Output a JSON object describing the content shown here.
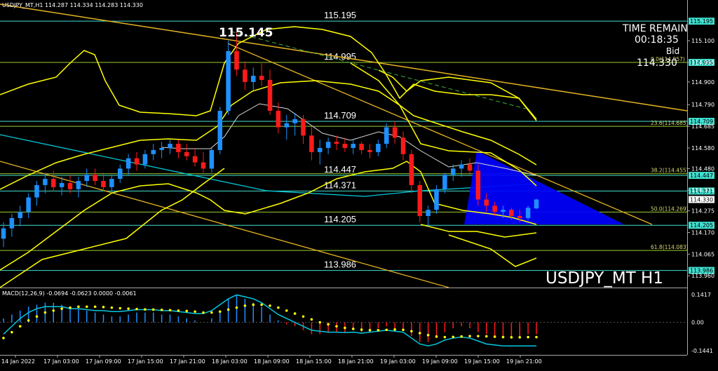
{
  "header": {
    "symbol_info": "USDJPY_MT,H1  114.287 114.334 114.283 114.330",
    "macd_info": "MACD(12,26,9) -0.0694 -0.0623 0.0000 -0.0061"
  },
  "overlay": {
    "time_remain_label": "TIME REMAIN",
    "time_remain_value": "00:18:35",
    "bid_label": "Bid",
    "bid_value": "114.330",
    "symbol_big": "USDJPY_MT H1",
    "peak_label": "115.145"
  },
  "colors": {
    "background": "#000000",
    "bull_candle": "#1e90ff",
    "bear_candle": "#ff1a1a",
    "bollinger": "#ffff00",
    "ma_fast": "#d8d8d8",
    "ma_cyan": "#00c8d8",
    "h_level": "#40e0d0",
    "fib_level": "#9acd32",
    "trendline": "#e6b422",
    "triangle": "#0000ff",
    "macd_signal": "#ffff00",
    "macd_line": "#00c8e0"
  },
  "levels": [
    {
      "price": 115.195,
      "label": "115.195",
      "axis": "115.195"
    },
    {
      "price": 114.995,
      "label": "114.995",
      "axis": "114.995"
    },
    {
      "price": 114.709,
      "label": "114.709",
      "axis": "114.709"
    },
    {
      "price": 114.447,
      "label": "114.447",
      "axis": "114.447"
    },
    {
      "price": 114.371,
      "label": "114.371",
      "axis": "114.371"
    },
    {
      "price": 114.205,
      "label": "114.205",
      "axis": "114.205"
    },
    {
      "price": 113.986,
      "label": "113.986",
      "axis": "113.986"
    }
  ],
  "fib_levels": [
    {
      "price": 114.995,
      "label": "0.0(114.957)"
    },
    {
      "price": 114.685,
      "label": "23.6(114.685)"
    },
    {
      "price": 114.455,
      "label": "38.2(114.455)"
    },
    {
      "price": 114.269,
      "label": "50.0(114.269)"
    },
    {
      "price": 114.083,
      "label": "61.8(114.083)"
    }
  ],
  "price_axis_ticks": [
    "115.100",
    "114.995",
    "114.900",
    "114.790",
    "114.685",
    "114.580",
    "114.480",
    "114.375",
    "114.275",
    "114.170",
    "114.065",
    "113.960"
  ],
  "macd_axis_ticks": [
    "0.1417",
    "0.00",
    "-0.1441"
  ],
  "time_axis": [
    "14 Jan 2022",
    "17 Jan 03:00",
    "17 Jan 09:00",
    "17 Jan 15:00",
    "17 Jan 21:00",
    "18 Jan 03:00",
    "18 Jan 09:00",
    "18 Jan 15:00",
    "18 Jan 21:00",
    "19 Jan 03:00",
    "19 Jan 09:00",
    "19 Jan 15:00",
    "19 Jan 21:00"
  ],
  "chart_data": {
    "type": "candlestick",
    "y_range": [
      113.92,
      115.25
    ],
    "current_price": 114.33,
    "candles": [
      [
        114.14,
        114.22,
        114.1,
        114.19
      ],
      [
        114.19,
        114.26,
        114.15,
        114.24
      ],
      [
        114.24,
        114.3,
        114.2,
        114.27
      ],
      [
        114.27,
        114.36,
        114.24,
        114.34
      ],
      [
        114.34,
        114.42,
        114.3,
        114.4
      ],
      [
        114.4,
        114.46,
        114.36,
        114.43
      ],
      [
        114.43,
        114.47,
        114.37,
        114.39
      ],
      [
        114.39,
        114.44,
        114.35,
        114.41
      ],
      [
        114.41,
        114.45,
        114.36,
        114.38
      ],
      [
        114.38,
        114.44,
        114.34,
        114.42
      ],
      [
        114.42,
        114.48,
        114.39,
        114.45
      ],
      [
        114.45,
        114.48,
        114.4,
        114.42
      ],
      [
        114.42,
        114.46,
        114.37,
        114.39
      ],
      [
        114.39,
        114.45,
        114.36,
        114.43
      ],
      [
        114.43,
        114.5,
        114.41,
        114.48
      ],
      [
        114.48,
        114.55,
        114.45,
        114.53
      ],
      [
        114.53,
        114.56,
        114.47,
        114.5
      ],
      [
        114.5,
        114.57,
        114.48,
        114.55
      ],
      [
        114.55,
        114.6,
        114.52,
        114.57
      ],
      [
        114.57,
        114.61,
        114.53,
        114.58
      ],
      [
        114.58,
        114.62,
        114.55,
        114.6
      ],
      [
        114.6,
        114.62,
        114.53,
        114.56
      ],
      [
        114.56,
        114.6,
        114.52,
        114.54
      ],
      [
        114.54,
        114.58,
        114.49,
        114.51
      ],
      [
        114.51,
        114.56,
        114.46,
        114.48
      ],
      [
        114.48,
        114.58,
        114.46,
        114.57
      ],
      [
        114.57,
        114.78,
        114.55,
        114.76
      ],
      [
        114.76,
        115.1,
        114.74,
        115.05
      ],
      [
        115.05,
        115.14,
        114.93,
        114.96
      ],
      [
        114.96,
        115.0,
        114.86,
        114.9
      ],
      [
        114.9,
        114.97,
        114.86,
        114.93
      ],
      [
        114.93,
        114.99,
        114.88,
        114.91
      ],
      [
        114.91,
        114.96,
        114.74,
        114.76
      ],
      [
        114.76,
        114.8,
        114.65,
        114.68
      ],
      [
        114.68,
        114.74,
        114.62,
        114.7
      ],
      [
        114.7,
        114.75,
        114.64,
        114.72
      ],
      [
        114.72,
        114.74,
        114.6,
        114.64
      ],
      [
        114.64,
        114.68,
        114.52,
        114.56
      ],
      [
        114.56,
        114.62,
        114.5,
        114.58
      ],
      [
        114.58,
        114.63,
        114.55,
        114.61
      ],
      [
        114.61,
        114.64,
        114.57,
        114.6
      ],
      [
        114.6,
        114.63,
        114.56,
        114.58
      ],
      [
        114.58,
        114.62,
        114.55,
        114.6
      ],
      [
        114.6,
        114.61,
        114.55,
        114.57
      ],
      [
        114.57,
        114.6,
        114.53,
        114.56
      ],
      [
        114.56,
        114.62,
        114.54,
        114.6
      ],
      [
        114.6,
        114.7,
        114.58,
        114.68
      ],
      [
        114.68,
        114.71,
        114.6,
        114.63
      ],
      [
        114.63,
        114.66,
        114.52,
        114.55
      ],
      [
        114.55,
        114.57,
        114.36,
        114.4
      ],
      [
        114.4,
        114.42,
        114.22,
        114.25
      ],
      [
        114.25,
        114.3,
        114.2,
        114.28
      ],
      [
        114.28,
        114.4,
        114.26,
        114.38
      ],
      [
        114.38,
        114.46,
        114.36,
        114.45
      ],
      [
        114.45,
        114.5,
        114.42,
        114.48
      ],
      [
        114.48,
        114.52,
        114.44,
        114.5
      ],
      [
        114.5,
        114.53,
        114.45,
        114.47
      ],
      [
        114.47,
        114.5,
        114.3,
        114.33
      ],
      [
        114.33,
        114.36,
        114.27,
        114.3
      ],
      [
        114.3,
        114.32,
        114.25,
        114.27
      ],
      [
        114.27,
        114.3,
        114.24,
        114.28
      ],
      [
        114.28,
        114.29,
        114.23,
        114.25
      ],
      [
        114.25,
        114.28,
        114.22,
        114.24
      ],
      [
        114.24,
        114.3,
        114.23,
        114.29
      ],
      [
        114.287,
        114.334,
        114.283,
        114.33
      ]
    ],
    "macd": {
      "histogram": [
        0.02,
        0.04,
        0.06,
        0.08,
        0.09,
        0.1,
        0.1,
        0.09,
        0.08,
        0.07,
        0.06,
        0.05,
        0.04,
        0.03,
        0.03,
        0.04,
        0.05,
        0.05,
        0.05,
        0.04,
        0.04,
        0.03,
        0.02,
        0.01,
        0.0,
        0.02,
        0.06,
        0.12,
        0.14,
        0.12,
        0.1,
        0.08,
        0.04,
        0.01,
        -0.01,
        -0.02,
        -0.04,
        -0.06,
        -0.06,
        -0.05,
        -0.05,
        -0.05,
        -0.04,
        -0.05,
        -0.04,
        -0.03,
        -0.02,
        -0.03,
        -0.04,
        -0.07,
        -0.1,
        -0.1,
        -0.08,
        -0.05,
        -0.03,
        -0.02,
        -0.03,
        -0.05,
        -0.06,
        -0.07,
        -0.07,
        -0.07,
        -0.07,
        -0.06,
        -0.06
      ],
      "signal": [
        -0.08,
        -0.05,
        -0.02,
        0.01,
        0.03,
        0.05,
        0.06,
        0.07,
        0.075,
        0.08,
        0.08,
        0.08,
        0.078,
        0.075,
        0.072,
        0.07,
        0.068,
        0.066,
        0.065,
        0.064,
        0.062,
        0.06,
        0.058,
        0.055,
        0.05,
        0.05,
        0.055,
        0.065,
        0.075,
        0.085,
        0.09,
        0.09,
        0.085,
        0.075,
        0.06,
        0.045,
        0.03,
        0.015,
        0.0,
        -0.01,
        -0.02,
        -0.028,
        -0.033,
        -0.037,
        -0.04,
        -0.04,
        -0.038,
        -0.036,
        -0.038,
        -0.045,
        -0.055,
        -0.065,
        -0.072,
        -0.075,
        -0.074,
        -0.072,
        -0.07,
        -0.07,
        -0.071,
        -0.073,
        -0.075,
        -0.076,
        -0.076,
        -0.075,
        -0.075
      ],
      "line": [
        -0.06,
        -0.02,
        0.02,
        0.05,
        0.07,
        0.08,
        0.08,
        0.08,
        0.07,
        0.07,
        0.065,
        0.06,
        0.06,
        0.055,
        0.055,
        0.06,
        0.065,
        0.065,
        0.065,
        0.06,
        0.06,
        0.055,
        0.05,
        0.045,
        0.045,
        0.06,
        0.09,
        0.12,
        0.14,
        0.13,
        0.12,
        0.1,
        0.07,
        0.04,
        0.02,
        0.0,
        -0.02,
        -0.04,
        -0.045,
        -0.05,
        -0.05,
        -0.052,
        -0.05,
        -0.055,
        -0.05,
        -0.045,
        -0.04,
        -0.045,
        -0.05,
        -0.08,
        -0.11,
        -0.12,
        -0.11,
        -0.09,
        -0.08,
        -0.075,
        -0.08,
        -0.095,
        -0.11,
        -0.115,
        -0.12,
        -0.12,
        -0.12,
        -0.12,
        -0.12
      ]
    }
  }
}
